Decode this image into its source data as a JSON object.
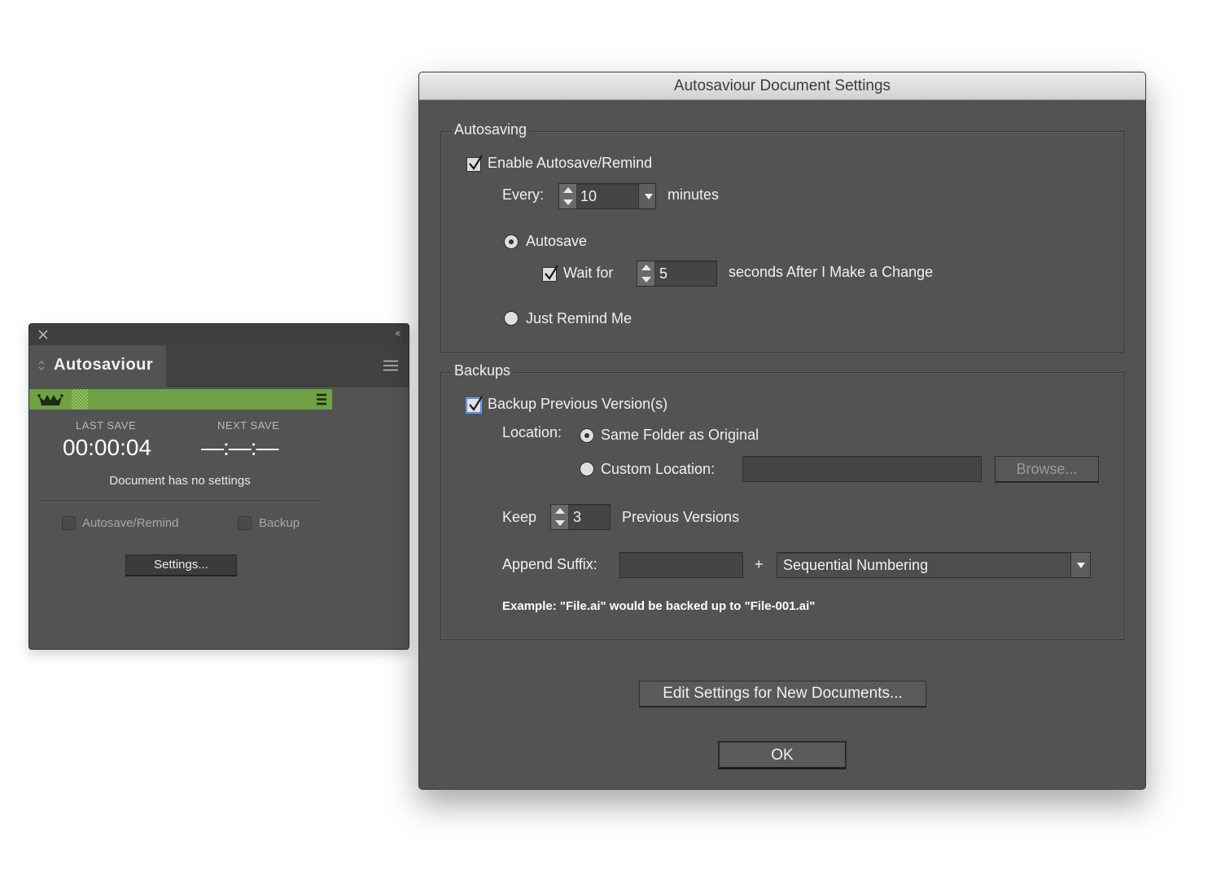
{
  "panel": {
    "title": "Autosaviour",
    "last_save_label": "LAST SAVE",
    "last_save_value": "00:00:04",
    "next_save_label": "NEXT SAVE",
    "next_save_value": "—:—:—",
    "message": "Document has no settings",
    "autosave_label": "Autosave/Remind",
    "backup_label": "Backup",
    "settings_button": "Settings...",
    "status_color": "#6ea243"
  },
  "dialog": {
    "title": "Autosaviour Document Settings",
    "autosaving": {
      "legend": "Autosaving",
      "enable_label": "Enable Autosave/Remind",
      "every_label": "Every:",
      "every_value": "10",
      "minutes_label": "minutes",
      "autosave_label": "Autosave",
      "wait_label": "Wait for",
      "wait_value": "5",
      "wait_suffix": "seconds After I Make a Change",
      "remind_label": "Just Remind Me"
    },
    "backups": {
      "legend": "Backups",
      "backup_label": "Backup Previous Version(s)",
      "location_label": "Location:",
      "same_folder_label": "Same Folder as Original",
      "custom_location_label": "Custom Location:",
      "custom_location_value": "",
      "browse_button": "Browse...",
      "keep_label": "Keep",
      "keep_value": "3",
      "previous_versions_label": "Previous Versions",
      "append_suffix_label": "Append Suffix:",
      "suffix_value": "",
      "plus": "+",
      "numbering_value": "Sequential Numbering",
      "example": "Example: \"File.ai\" would be backed up to \"File-001.ai\""
    },
    "edit_new_button": "Edit Settings for New Documents...",
    "ok_button": "OK"
  }
}
